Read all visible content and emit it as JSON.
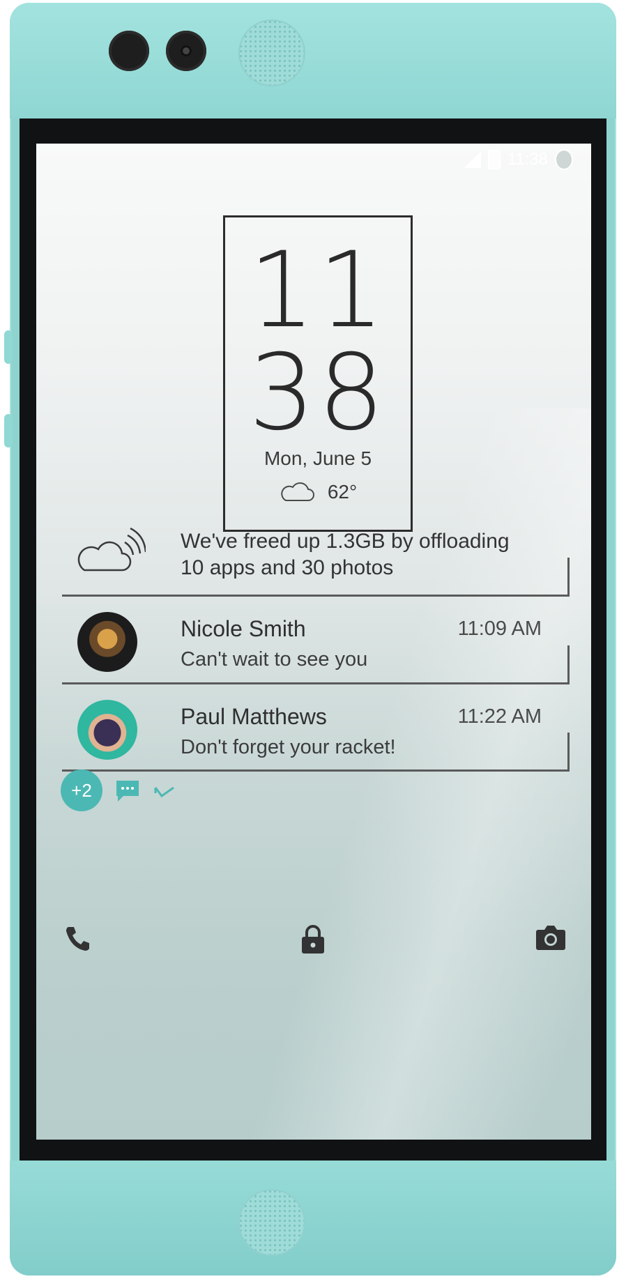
{
  "status_bar": {
    "time": "11:38",
    "icons": [
      "signal-icon",
      "battery-icon",
      "robot-icon"
    ]
  },
  "clock": {
    "hour": "11",
    "minute": "38",
    "date": "Mon, June 5",
    "temperature": "62°",
    "weather_icon": "cloud-icon"
  },
  "storage_notification": {
    "icon": "cloud-sync-icon",
    "line1": "We've freed up 1.3GB by offloading",
    "line2": "10 apps and 30 photos"
  },
  "messages": [
    {
      "name": "Nicole Smith",
      "time": "11:09 AM",
      "text": "Can't wait to see you"
    },
    {
      "name": "Paul Matthews",
      "time": "11:22 AM",
      "text": "Don't forget your racket!"
    }
  ],
  "actions": {
    "more_count": "+2",
    "reply_icon": "chat-bubble-icon",
    "dismiss_icon": "check-icon"
  },
  "dock": [
    "phone-icon",
    "lock-icon",
    "camera-icon"
  ],
  "colors": {
    "accent": "#4cb8b4",
    "body": "#8fd3cf"
  }
}
